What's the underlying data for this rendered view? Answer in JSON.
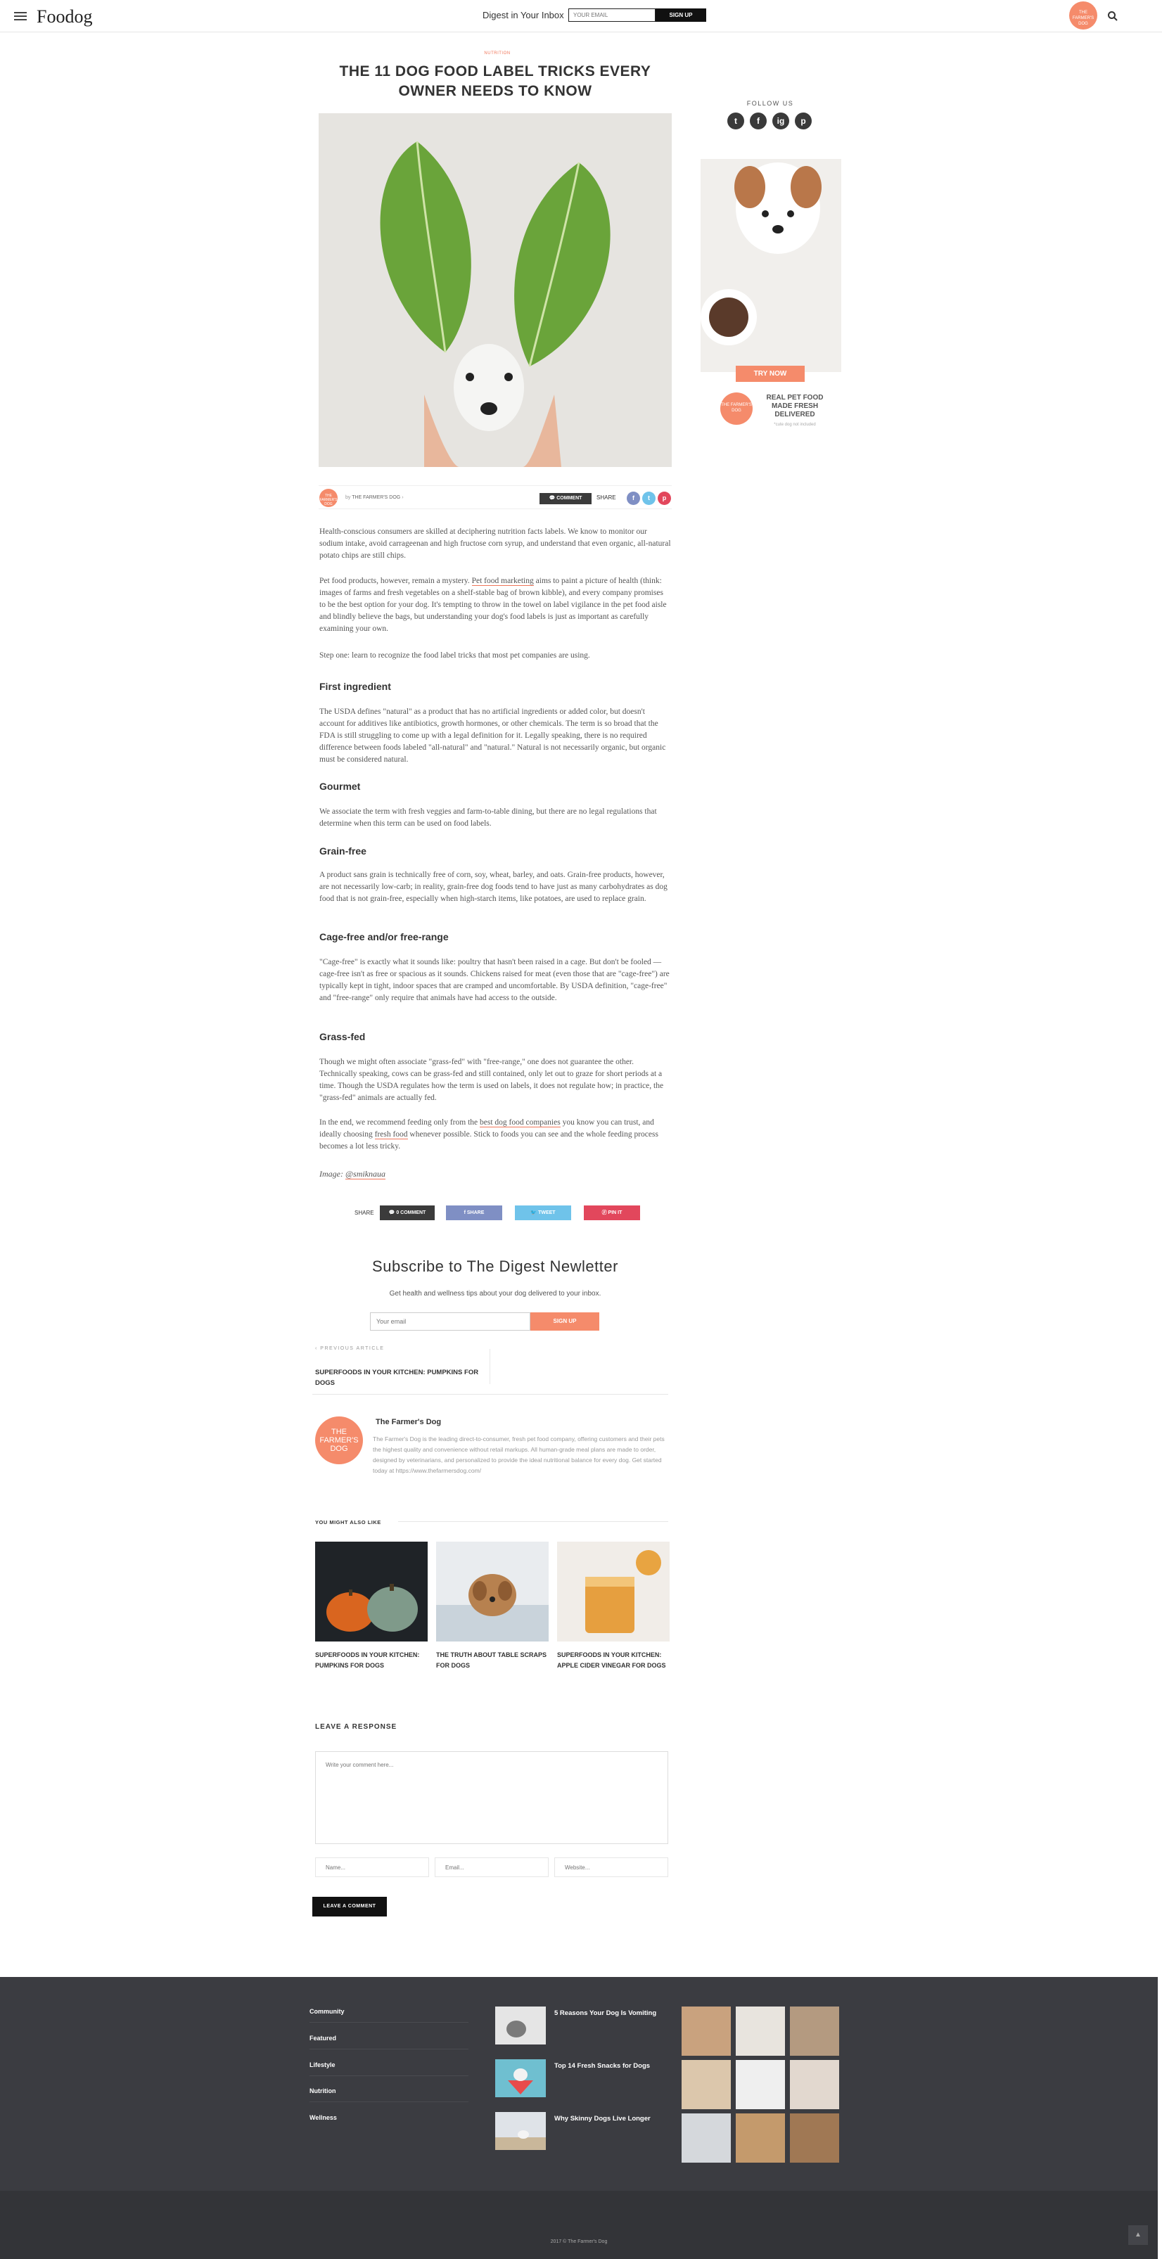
{
  "header": {
    "logo": "Foodog",
    "digest_label": "Digest in Your Inbox",
    "email_placeholder": "YOUR EMAIL",
    "signup_label": "SIGN UP",
    "badge_text": "THE FARMER'S DOG"
  },
  "article": {
    "category": "NUTRITION",
    "title": "THE 11 DOG FOOD LABEL TRICKS EVERY OWNER NEEDS TO KNOW",
    "by_prefix": "by",
    "author": "THE FARMER'S DOG",
    "comment_label": "COMMENT",
    "share_label": "SHARE",
    "intro1": "Health-conscious consumers are skilled at deciphering nutrition facts labels. We know to monitor our sodium intake, avoid carrageenan and high fructose corn syrup, and understand that even organic, all-natural potato chips are still chips.",
    "intro2_a": "Pet food products, however, remain a mystery.",
    "intro2_link": "Pet food marketing",
    "intro2_b": "aims to paint a picture of health (think: images of farms and fresh vegetables on a shelf-stable bag of brown kibble), and every company promises to be the best option for your dog. It's tempting to throw in the towel on label vigilance in the pet food aisle and blindly believe the bags, but understanding your dog's food labels is just as important as carefully examining your own.",
    "intro3": "Step one: learn to recognize the food label tricks that most pet companies are using.",
    "sections": [
      {
        "heading": "First ingredient",
        "text": "The USDA defines \"natural\" as a product that has no artificial ingredients or added color, but doesn't account for additives like antibiotics, growth hormones, or other chemicals. The term is so broad that the FDA is still struggling to come up with a legal definition for it. Legally speaking, there is no required difference between foods labeled \"all-natural\" and \"natural.\" Natural is not necessarily organic, but organic must be considered natural."
      },
      {
        "heading": "Gourmet",
        "text": "We associate the term with fresh veggies and farm-to-table dining, but there are no legal regulations that determine when this term can be used on food labels."
      },
      {
        "heading": "Grain-free",
        "text": "A product sans grain is technically free of corn, soy, wheat, barley, and oats. Grain-free products, however, are not necessarily low-carb; in reality, grain-free dog foods tend to have just as many carbohydrates as dog food that is not grain-free, especially when high-starch items, like potatoes, are used to replace grain."
      },
      {
        "heading": "Cage-free and/or free-range",
        "text": "\"Cage-free\" is exactly what it sounds like: poultry that hasn't been raised in a cage. But don't be fooled — cage-free isn't as free or spacious as it sounds. Chickens raised for meat (even those that are \"cage-free\") are typically kept in tight, indoor spaces that are cramped and uncomfortable. By USDA definition, \"cage-free\" and \"free-range\" only require that animals have had access to the outside."
      },
      {
        "heading": "Grass-fed",
        "text": "Though we might often associate \"grass-fed\" with \"free-range,\" one does not guarantee the other. Technically speaking, cows can be grass-fed and still contained, only let out to graze for short periods at a time. Though the USDA regulates how the term is used on labels, it does not regulate how; in practice, the \"grass-fed\" animals are actually fed."
      }
    ],
    "closing_a": "In the end, we recommend feeding only from the",
    "closing_link1": "best dog food companies",
    "closing_b": "you know you can trust, and ideally choosing",
    "closing_link2": "fresh food",
    "closing_c": "whenever possible. Stick to foods you can see and the whole feeding process becomes a lot less tricky.",
    "caption_prefix": "Image:",
    "caption_link": "@smiknaua"
  },
  "share_bar": {
    "label": "SHARE",
    "comment": "0 COMMENT",
    "facebook": "SHARE",
    "twitter": "TWEET",
    "pinterest": "PIN IT"
  },
  "sidebar": {
    "follow": "FOLLOW US",
    "social": [
      "t",
      "f",
      "ig",
      "p"
    ],
    "try_now": "TRY NOW",
    "ad_badge": "THE FARMER'S DOG",
    "ad_text": "REAL PET FOOD MADE FRESH DELIVERED",
    "ad_sub": "*cute dog not included"
  },
  "newsletter": {
    "title": "Subscribe to The Digest Newletter",
    "subtitle": "Get health and wellness tips about your dog delivered to your inbox.",
    "placeholder": "Your email",
    "button": "SIGN UP"
  },
  "prev_article": {
    "label": "PREVIOUS ARTICLE",
    "title": "SUPERFOODS IN YOUR KITCHEN: PUMPKINS FOR DOGS"
  },
  "author_box": {
    "badge": "THE FARMER'S DOG",
    "name": "The Farmer's Dog",
    "bio": "The Farmer's Dog is the leading direct-to-consumer, fresh pet food company, offering customers and their pets the highest quality and convenience without retail markups. All human-grade meal plans are made to order, designed by veterinarians, and personalized to provide the ideal nutritional balance for every dog. Get started today at https://www.thefarmersdog.com/"
  },
  "related": {
    "label": "YOU MIGHT ALSO LIKE",
    "items": [
      {
        "title": "SUPERFOODS IN YOUR KITCHEN: PUMPKINS FOR DOGS"
      },
      {
        "title": "THE TRUTH ABOUT TABLE SCRAPS FOR DOGS"
      },
      {
        "title": "SUPERFOODS IN YOUR KITCHEN: APPLE CIDER VINEGAR FOR DOGS"
      }
    ]
  },
  "response": {
    "label": "LEAVE A RESPONSE",
    "comment_placeholder": "Write your comment here...",
    "name_placeholder": "Name...",
    "email_placeholder": "Email...",
    "website_placeholder": "Website...",
    "submit": "LEAVE A COMMENT"
  },
  "footer": {
    "links": [
      "Community",
      "Featured",
      "Lifestyle",
      "Nutrition",
      "Wellness"
    ],
    "posts": [
      {
        "title": "5 Reasons Your Dog Is Vomiting"
      },
      {
        "title": "Top 14 Fresh Snacks for Dogs"
      },
      {
        "title": "Why Skinny Dogs Live Longer"
      }
    ],
    "copyright": "2017 © The Farmer's Dog",
    "to_top": "▲"
  },
  "colors": {
    "accent": "#f58b6b",
    "footer": "#3b3c41",
    "facebook": "#7f8fc4",
    "twitter": "#6fc3ea",
    "pinterest": "#e2475c"
  }
}
